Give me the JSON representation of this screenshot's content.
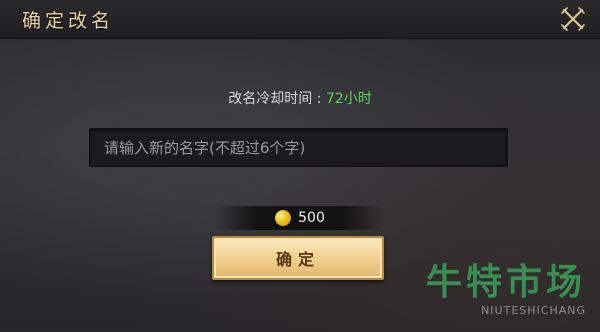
{
  "dialog": {
    "title": "确定改名",
    "close_icon": "close-icon-crossed-swords"
  },
  "cooldown": {
    "label": "改名冷却时间 :",
    "value": "72小时",
    "value_color": "#5bd45b"
  },
  "name_input": {
    "value": "",
    "placeholder": "请输入新的名字(不超过6个字)"
  },
  "cost": {
    "icon": "gold-coin-icon",
    "amount": "500"
  },
  "confirm_button": {
    "label": "确定"
  },
  "watermark": {
    "text_cn": "牛特市场",
    "text_en": "NIUTESHICHANG"
  }
}
